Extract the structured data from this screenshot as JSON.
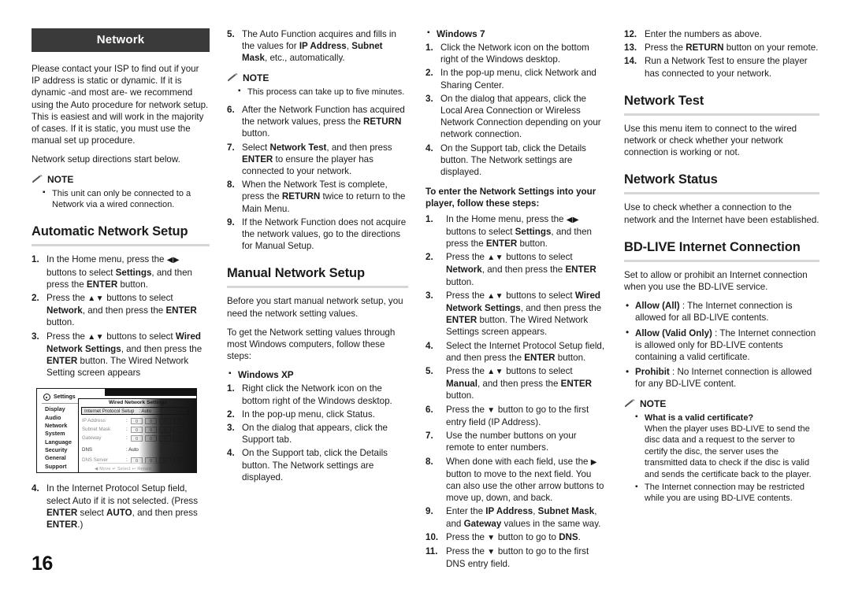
{
  "page": {
    "number": "16",
    "chapter_title": "Network"
  },
  "intro": {
    "paragraph": "Please contact your ISP to find out if your IP address is static or dynamic. If it is dynamic -and most are- we recommend using the Auto procedure for network setup. This is easiest and will work in the majority of cases. If it is static, you must use the manual set up procedure.",
    "paragraph2": "Network setup directions start below.",
    "note_label": "NOTE",
    "note_items": [
      "This unit can only be connected to a Network via a wired connection."
    ]
  },
  "automatic_setup": {
    "heading": "Automatic Network Setup",
    "steps": [
      {
        "num": "1.",
        "html": "In the Home menu, press the <span class=\"arrows\">◀▶</span> buttons to select <b>Settings</b>, and then press the <b>ENTER</b> button."
      },
      {
        "num": "2.",
        "html": "Press the <span class=\"arrows\">▲▼</span> buttons to select <b>Network</b>, and then press the <b>ENTER</b> button."
      },
      {
        "num": "3.",
        "html": "Press the <span class=\"arrows\">▲▼</span> buttons to select <b>Wired Network Settings</b>, and then press the <b>ENTER</b> button. The Wired Network Setting screen appears"
      }
    ],
    "steps_after": [
      {
        "num": "4.",
        "html": "In the Internet Protocol Setup field, select Auto if it is not selected. (Press <b>ENTER</b> select <b>AUTO</b>, and then press <b>ENTER</b>.)"
      }
    ],
    "steps_col2": [
      {
        "num": "5.",
        "html": "The Auto Function acquires and fills in the values for <b>IP Address</b>, <b>Subnet Mask</b>, etc., automatically."
      }
    ],
    "note_label": "NOTE",
    "note_items": [
      "This process can take up to five minutes."
    ],
    "steps_col2b": [
      {
        "num": "6.",
        "html": "After the Network Function has acquired the network values, press the <b>RETURN</b> button."
      },
      {
        "num": "7.",
        "html": "Select <b>Network Test</b>, and then press <b>ENTER</b> to ensure the player has connected to your network."
      },
      {
        "num": "8.",
        "html": "When the Network Test is complete, press the <b>RETURN</b> twice to return to the Main Menu."
      },
      {
        "num": "9.",
        "html": "If the Network Function does not acquire the network values, go to the directions for Manual Setup."
      }
    ]
  },
  "settings_screen": {
    "title": "Settings",
    "panel_title": "Wired Network Settings",
    "menu_items": [
      "Display",
      "Audio",
      "Network",
      "System",
      "Language",
      "Security",
      "General",
      "Support"
    ],
    "selected_row_label": "Internet Protocol Setup",
    "selected_row_value": ": Auto",
    "rows": [
      {
        "label": "IP Address",
        "colon": ":",
        "octets": [
          "0",
          "0",
          "0",
          "0"
        ]
      },
      {
        "label": "Subnet Mask",
        "colon": ":",
        "octets": [
          "0",
          "0",
          "0",
          "0"
        ]
      },
      {
        "label": "Gateway",
        "colon": ":",
        "octets": [
          "0",
          "0",
          "0",
          "0"
        ]
      }
    ],
    "dns_label": "DNS",
    "dns_value": ": Auto",
    "dns_server_label": "DNS Server",
    "dns_server_octets": [
      "0",
      "0",
      "0",
      "0"
    ],
    "footer": "◀ Move    ↵ Select    ↩ Return"
  },
  "manual_setup": {
    "heading": "Manual Network Setup",
    "paragraph1": "Before you start manual network setup, you need the network setting values.",
    "paragraph2": "To get the Network setting values through most Windows computers, follow these steps:",
    "winxp_label": "Windows XP",
    "winxp_steps": [
      {
        "num": "1.",
        "html": "Right click the Network icon on the bottom right of the Windows desktop."
      },
      {
        "num": "2.",
        "html": "In the pop-up menu, click Status."
      },
      {
        "num": "3.",
        "html": "On the dialog that appears, click the Support tab."
      },
      {
        "num": "4.",
        "html": "On the Support tab, click the Details button. The Network settings are displayed."
      }
    ],
    "win7_label": "Windows 7",
    "win7_steps": [
      {
        "num": "1.",
        "html": "Click the Network icon on the bottom right of the Windows desktop."
      },
      {
        "num": "2.",
        "html": "In the pop-up menu, click Network and Sharing Center."
      },
      {
        "num": "3.",
        "html": "On the dialog that appears, click the Local Area Connection or Wireless Network Connection depending on your network connection."
      },
      {
        "num": "4.",
        "html": "On the Support tab, click the Details button. The Network settings are displayed."
      }
    ],
    "enter_lead": "To enter the Network Settings into your player, follow these steps:",
    "enter_steps": [
      {
        "num": "1.",
        "html": "In the Home menu, press the <span class=\"arrows\">◀▶</span> buttons to select <b>Settings</b>, and then press the <b>ENTER</b> button."
      },
      {
        "num": "2.",
        "html": "Press the <span class=\"arrows\">▲▼</span> buttons to select <b>Network</b>, and then press the <b>ENTER</b> button."
      },
      {
        "num": "3.",
        "html": "Press the <span class=\"arrows\">▲▼</span> buttons to select <b>Wired Network Settings</b>, and then press the <b>ENTER</b> button. The Wired Network Settings screen appears."
      },
      {
        "num": "4.",
        "html": "Select the Internet Protocol Setup field, and then press the <b>ENTER</b> button."
      },
      {
        "num": "5.",
        "html": "Press the <span class=\"arrows\">▲▼</span> buttons to select <b>Manual</b>, and then press the <b>ENTER</b> button."
      },
      {
        "num": "6.",
        "html": "Press the <span class=\"arrows\">▼</span> button to go to the first entry field (IP Address)."
      },
      {
        "num": "7.",
        "html": "Use the number buttons on your remote to enter numbers."
      },
      {
        "num": "8.",
        "html": "When done with each field, use the <span class=\"arrows\">▶</span> button to move to the next field. You can also use the other arrow buttons to move up, down, and back."
      },
      {
        "num": "9.",
        "html": "Enter the <b>IP Address</b>, <b>Subnet Mask</b>, and <b>Gateway</b> values in the same way."
      },
      {
        "num": "10.",
        "html": "Press the <span class=\"arrows\">▼</span> button to go to <b>DNS</b>."
      },
      {
        "num": "11.",
        "html": "Press the <span class=\"arrows\">▼</span> button to go to the first DNS entry field."
      },
      {
        "num": "12.",
        "html": "Enter the numbers as above."
      },
      {
        "num": "13.",
        "html": "Press the <b>RETURN</b> button on your remote."
      },
      {
        "num": "14.",
        "html": "Run a Network Test to ensure the player has connected to your network."
      }
    ]
  },
  "network_test": {
    "heading": "Network Test",
    "paragraph": "Use this menu item to connect to the wired network or check whether your network connection is working or not."
  },
  "network_status": {
    "heading": "Network Status",
    "paragraph": "Use to check whether a connection to the network and the Internet have been established."
  },
  "bdlive": {
    "heading": "BD-LIVE Internet Connection",
    "paragraph": "Set to allow or prohibit an Internet connection when you use the BD-LIVE service.",
    "options": [
      {
        "html": "<b>Allow (All)</b> : The Internet connection is allowed for all BD-LIVE contents."
      },
      {
        "html": "<b>Allow (Valid Only)</b> : The Internet connection is allowed only for BD-LIVE contents containing a valid certificate."
      },
      {
        "html": "<b>Prohibit</b> : No Internet connection is allowed for any BD-LIVE content."
      }
    ],
    "note_label": "NOTE",
    "note_items": [
      {
        "title": "What is a valid certificate?",
        "text": "When the player uses BD-LIVE to send the disc data and a request to the server to certify the disc, the server uses the transmitted data to check if the disc is valid and sends the certificate back to the player."
      },
      {
        "title": "",
        "text": "The Internet connection may be restricted while you are using BD-LIVE contents."
      }
    ]
  }
}
